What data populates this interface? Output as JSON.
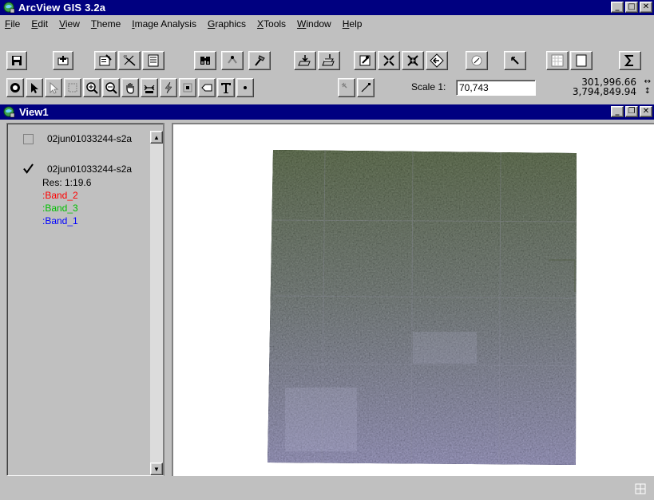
{
  "app": {
    "title": "ArcView GIS 3.2a"
  },
  "menu": [
    "File",
    "Edit",
    "View",
    "Theme",
    "Image Analysis",
    "Graphics",
    "XTools",
    "Window",
    "Help"
  ],
  "scale": {
    "label": "Scale 1:",
    "value": "70,743"
  },
  "coords": {
    "x": "301,996.66",
    "y": "3,794,849.94"
  },
  "view": {
    "title": "View1"
  },
  "toc": {
    "themes": [
      {
        "name": "02jun01033244-s2a",
        "checked": false
      },
      {
        "name": "02jun01033244-s2a",
        "checked": true,
        "res": "Res: 1:19.6",
        "bands": [
          ":Band_2",
          ":Band_3",
          ":Band_1"
        ]
      }
    ]
  },
  "colors": {
    "title_bar": "#000080",
    "band_red": "#ff0000",
    "band_green": "#00c000",
    "band_blue": "#0000ff"
  }
}
